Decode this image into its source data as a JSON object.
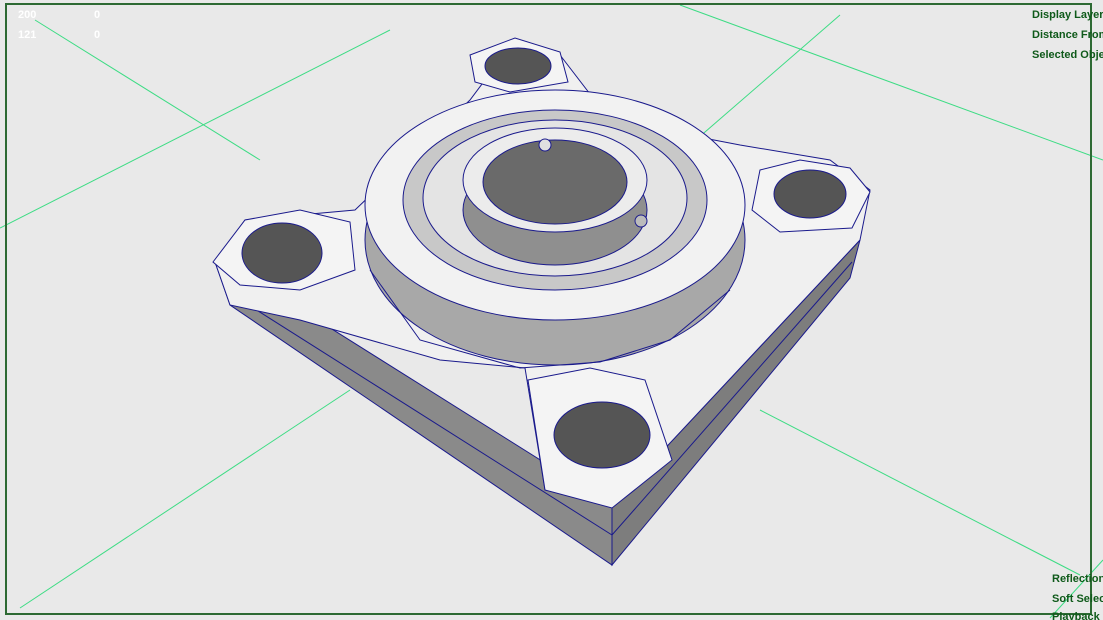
{
  "hud": {
    "poly_stats": [
      {
        "a": "200",
        "b": "0"
      },
      {
        "a": "121",
        "b": "0"
      }
    ],
    "top_right": [
      "Display Layer",
      "Distance From",
      "Selected Obje"
    ],
    "bottom_right": [
      "Reflection",
      "Soft Select",
      "Playback"
    ]
  },
  "colors": {
    "background": "#e9e9e9",
    "grid": "#3ddc84",
    "wireframe": "#1a1a8c",
    "hud_text": "#0f5a1a"
  },
  "icons": {
    "model": "pillow-block-bearing-wireframe"
  }
}
